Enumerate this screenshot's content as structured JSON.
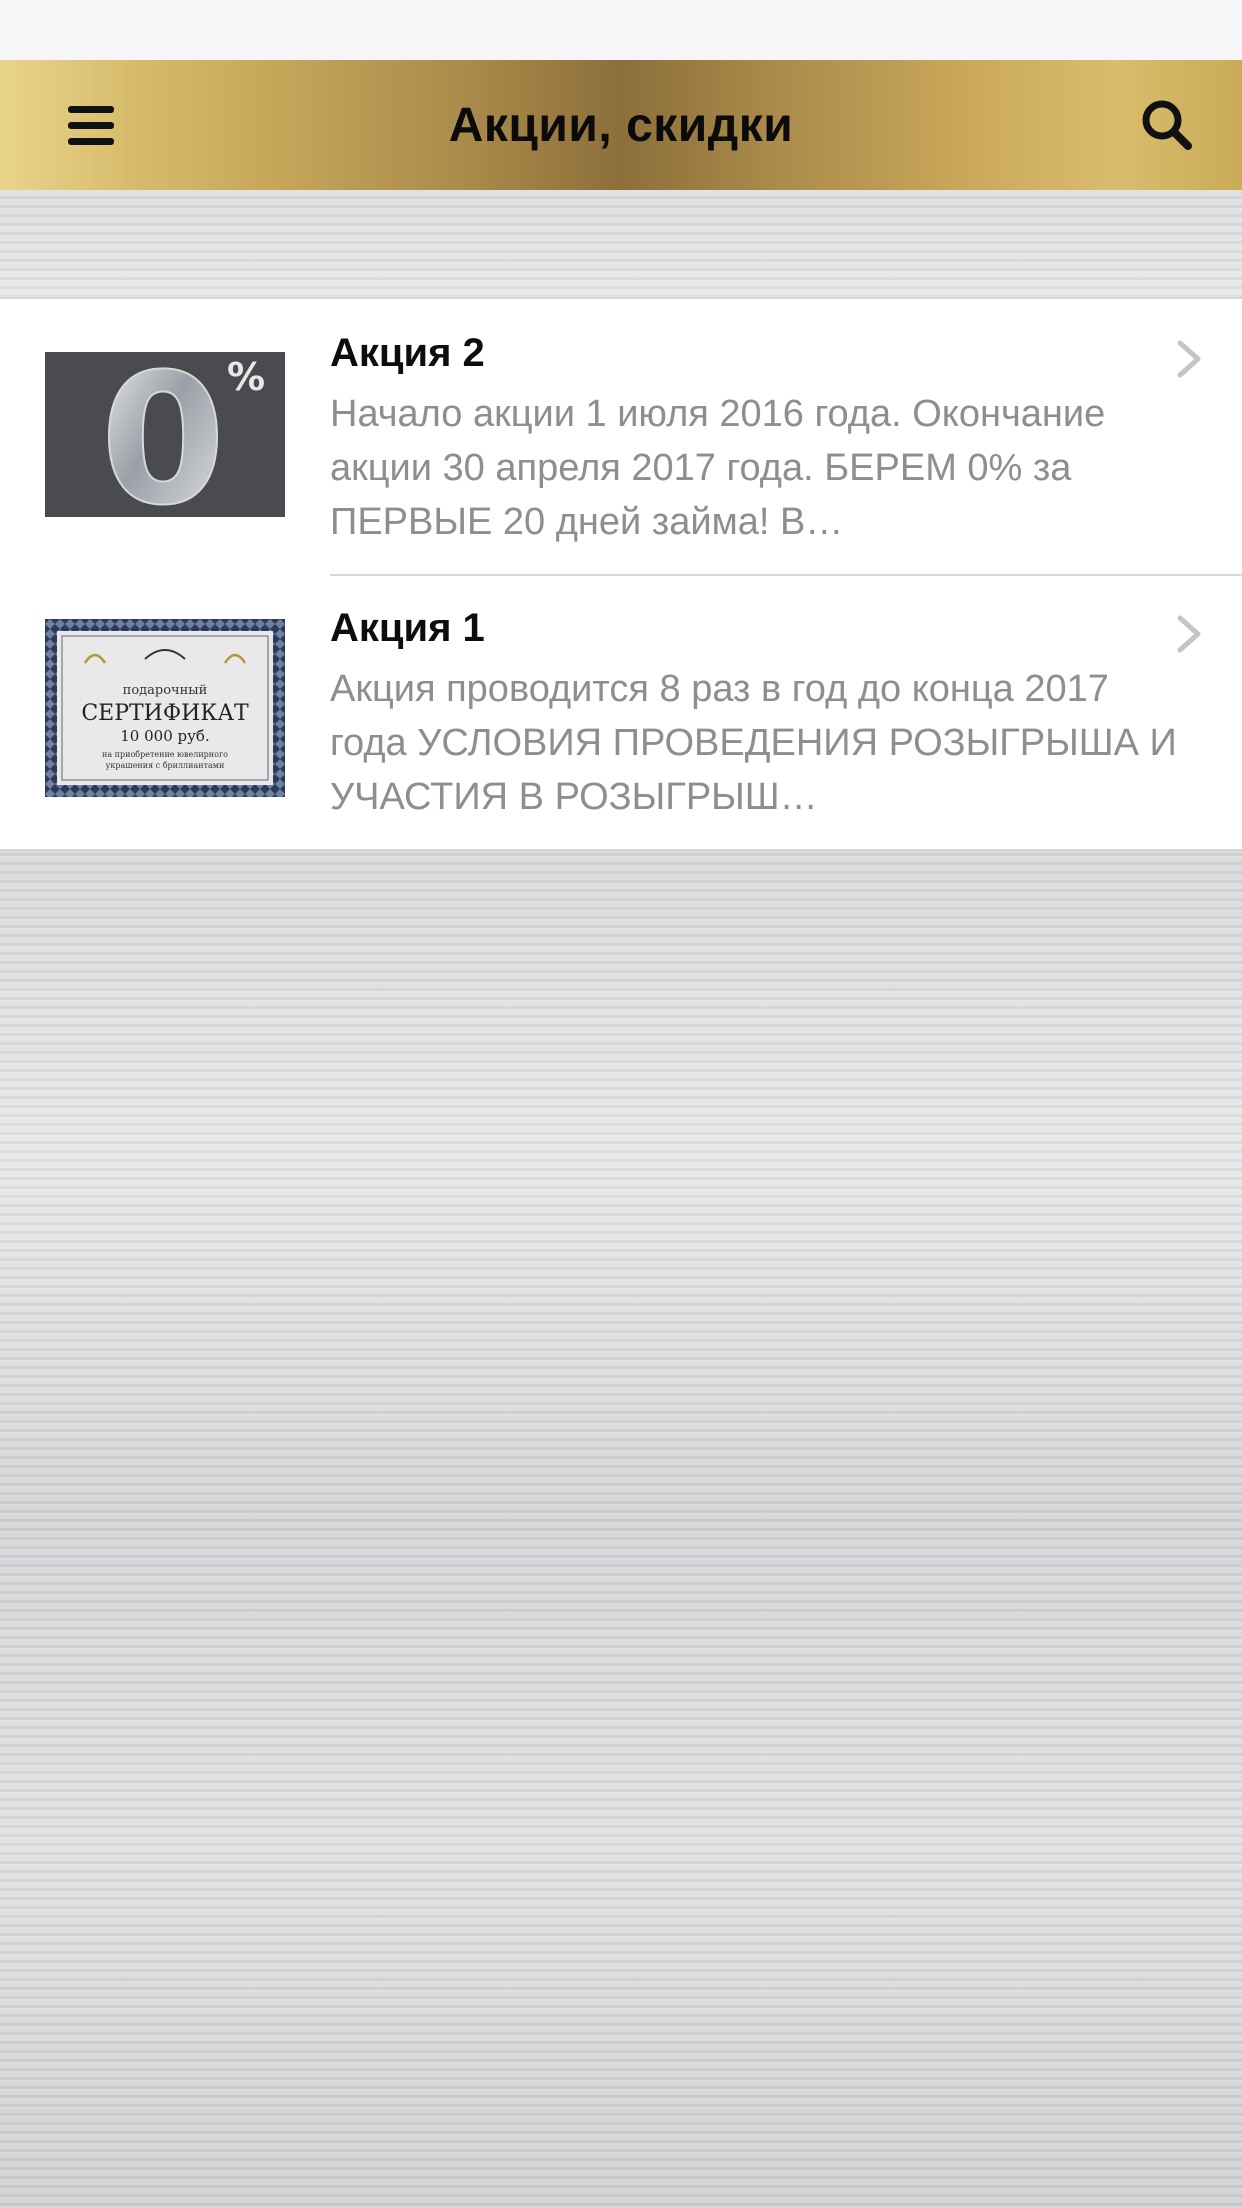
{
  "header": {
    "title": "Акции, скидки",
    "menu_icon": "hamburger-menu-icon",
    "search_icon": "search-icon",
    "accent_color": "#b8995a"
  },
  "promotions": [
    {
      "title": "Акция 2",
      "description": "Начало акции 1 июля 2016 года. Окончание акции 30 апреля 2017 года. БЕРЕМ 0% за ПЕРВЫЕ 20 дней займа! В…",
      "thumbnail": {
        "big_text": "0",
        "small_text": "%"
      }
    },
    {
      "title": "Акция 1",
      "description": "Акция проводится 8 раз в год до конца 2017 года УСЛОВИЯ ПРОВЕДЕНИЯ РОЗЫГРЫША И УЧАСТИЯ В РОЗЫГРЫШ…",
      "thumbnail": {
        "line1": "подарочный",
        "line2": "СЕРТИФИКАТ",
        "line3": "10 000 руб.",
        "line4": "на приобретение ювелирного",
        "line5": "украшения с бриллиантами"
      }
    }
  ]
}
